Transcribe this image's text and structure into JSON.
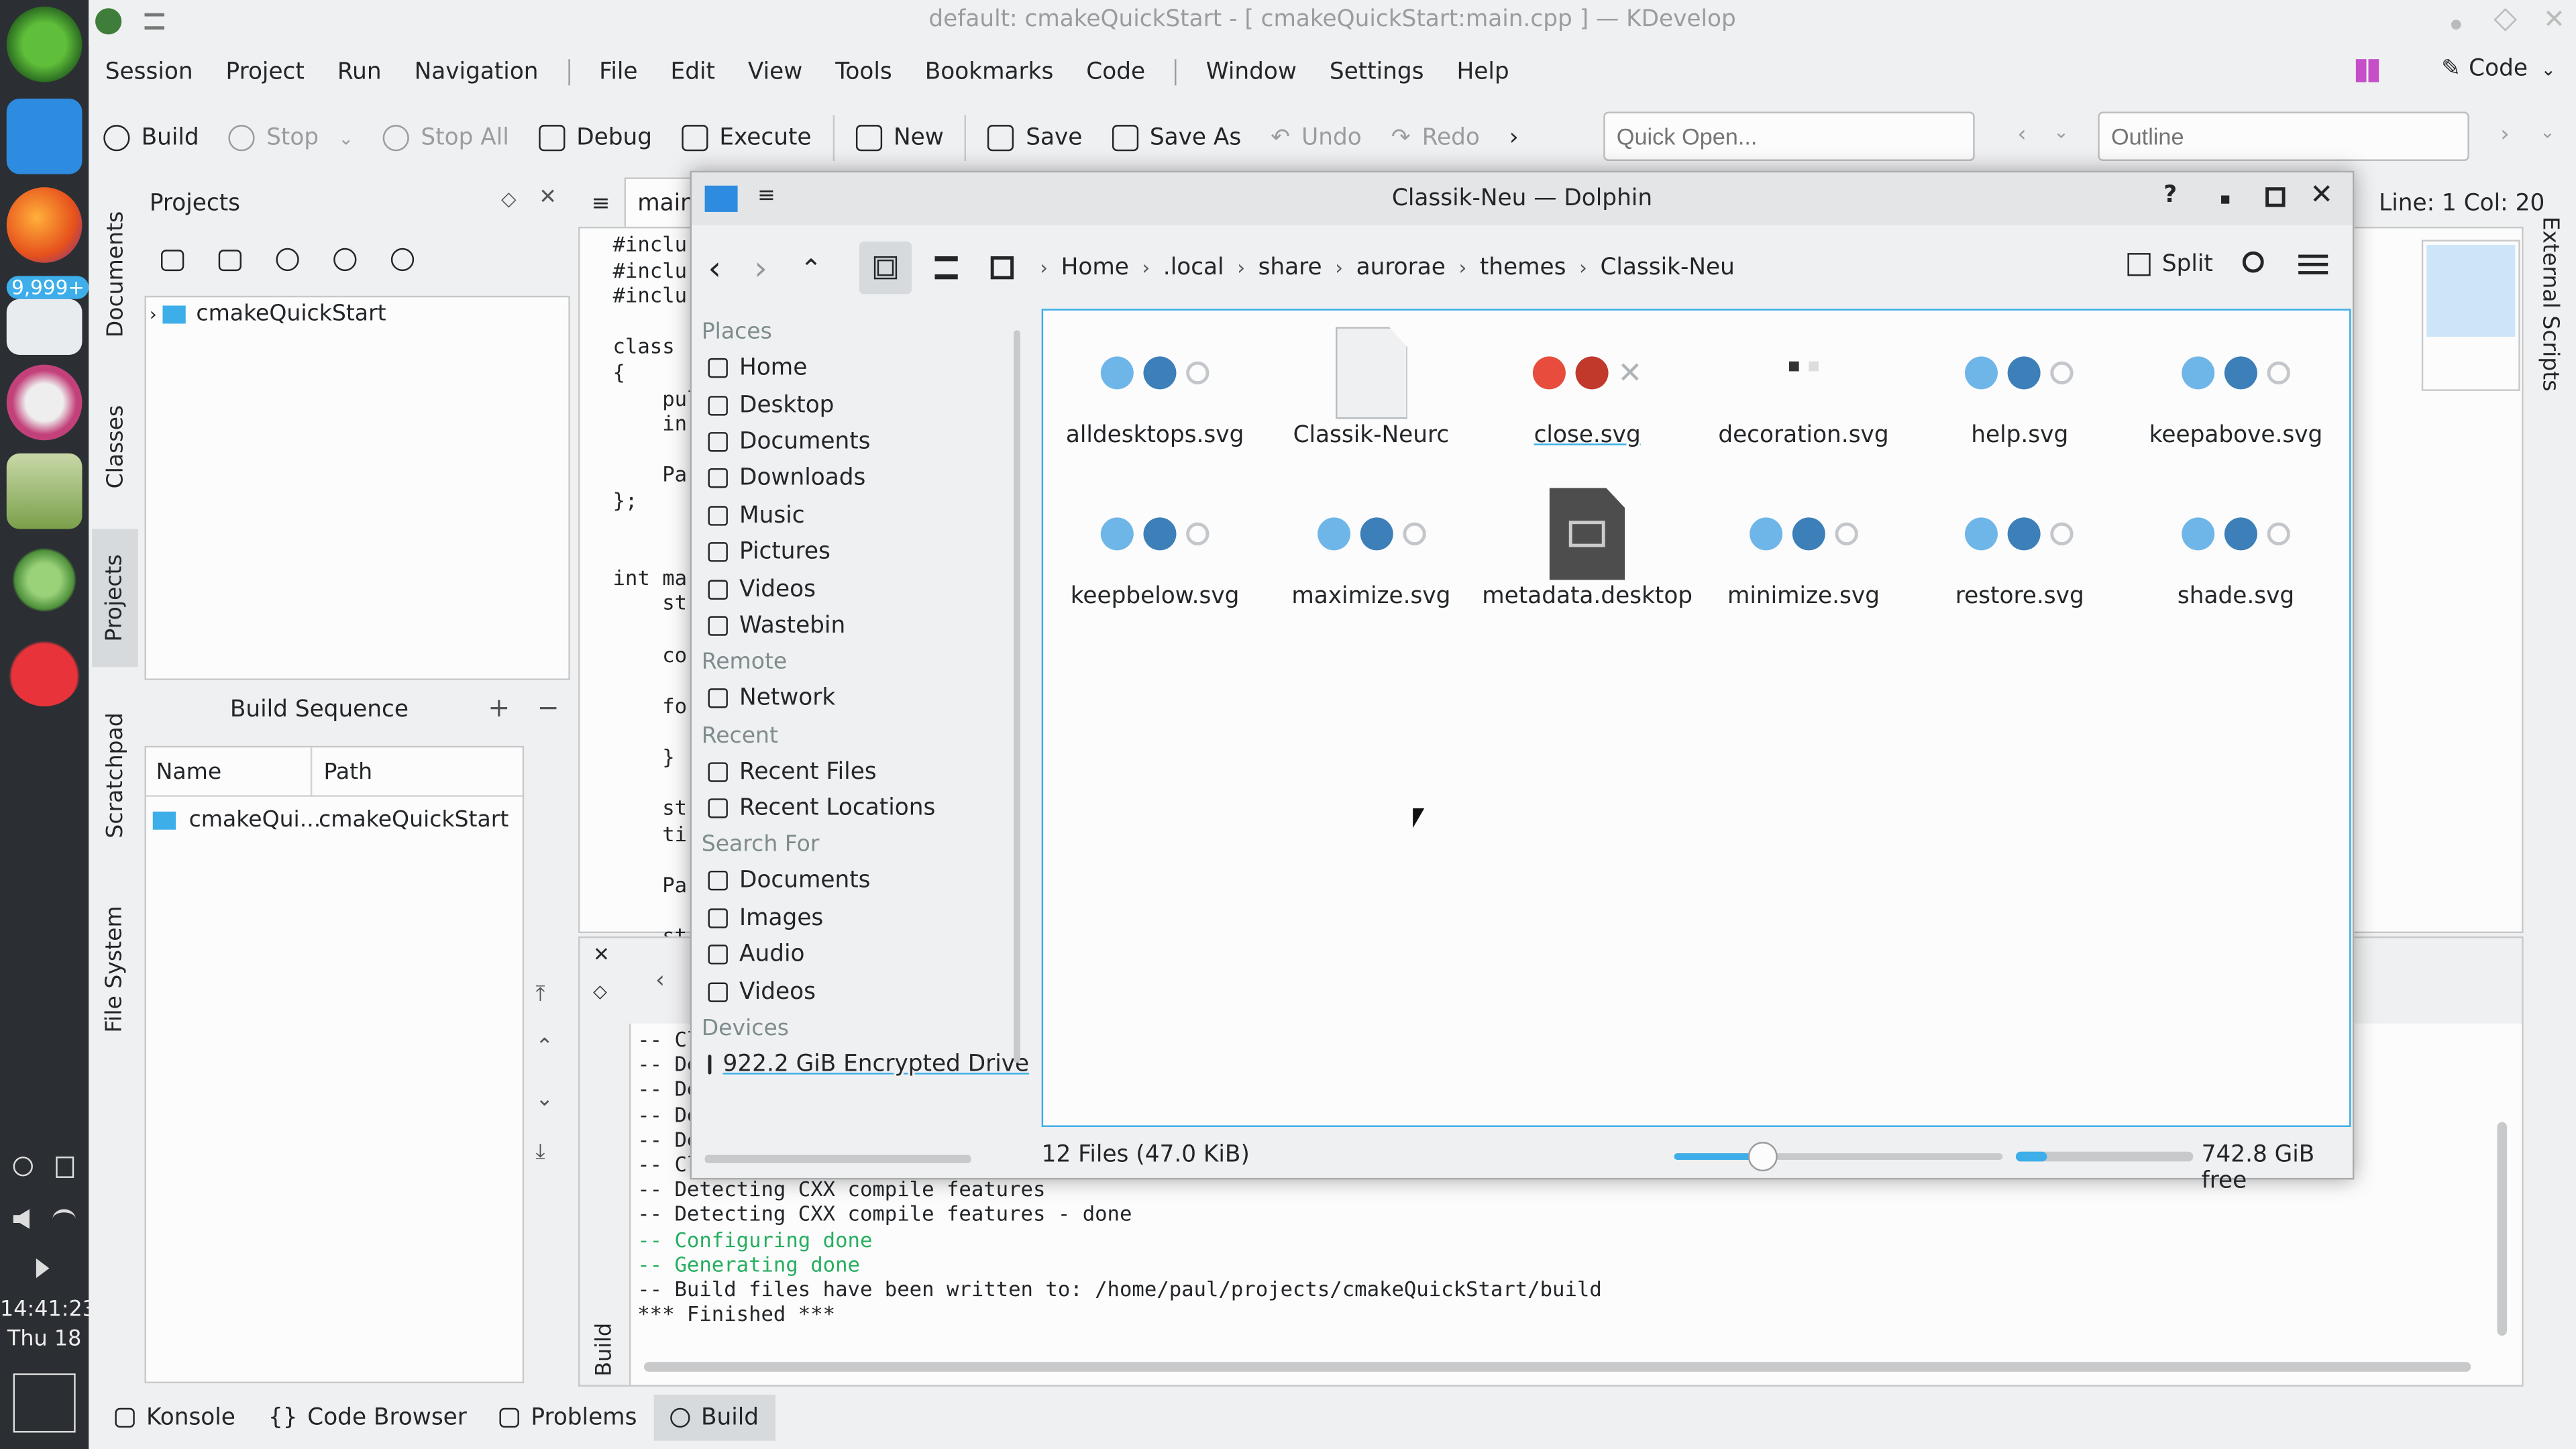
{
  "window_title": "default: cmakeQuickStart - [ cmakeQuickStart:main.cpp ] — KDevelop",
  "dock": {
    "badge": "9,999+",
    "time": "14:41:23",
    "date": "Thu 18"
  },
  "menu": [
    "Session",
    "Project",
    "Run",
    "Navigation",
    "File",
    "Edit",
    "View",
    "Tools",
    "Bookmarks",
    "Code",
    "Window",
    "Settings",
    "Help"
  ],
  "area_switch": "Code",
  "toolbar": {
    "build": "Build",
    "stop": "Stop",
    "stop_all": "Stop All",
    "debug": "Debug",
    "execute": "Execute",
    "new": "New",
    "save": "Save",
    "save_as": "Save As",
    "undo": "Undo",
    "redo": "Redo",
    "quick_open_placeholder": "Quick Open...",
    "outline_placeholder": "Outline"
  },
  "side_tabs": [
    "Documents",
    "Classes",
    "Projects",
    "Scratchpad",
    "File System"
  ],
  "projects_panel": {
    "title": "Projects",
    "tree_item": "cmakeQuickStart"
  },
  "build_sequence": {
    "title": "Build Sequence",
    "col_name": "Name",
    "col_path": "Path",
    "row_name": "cmakeQui...",
    "row_path": "cmakeQuickStart"
  },
  "editor": {
    "tab": "main",
    "lines": [
      "#inclu",
      "#inclu",
      "#inclu",
      "",
      "class",
      "{",
      "    pul",
      "    in",
      "",
      "    Pa",
      "};",
      "",
      "",
      "int ma",
      "    st",
      "",
      "    co",
      "",
      "    fo",
      "",
      "    }",
      "",
      "    st",
      "    ti",
      "",
      "    Pa",
      "",
      "    st"
    ],
    "cursor": "Line: 1 Col: 20",
    "right_tab": "External Scripts"
  },
  "output": {
    "side_label": "Build",
    "lines": [
      {
        "text": "-- Cl",
        "green": false
      },
      {
        "text": "-- De",
        "green": false
      },
      {
        "text": "-- De",
        "green": false
      },
      {
        "text": "-- De",
        "green": false
      },
      {
        "text": "-- De",
        "green": false
      },
      {
        "text": "-- Cl",
        "green": false
      },
      {
        "text": "-- Detecting CXX compile features",
        "green": false
      },
      {
        "text": "-- Detecting CXX compile features - done",
        "green": false
      },
      {
        "text": "-- Configuring done",
        "green": true
      },
      {
        "text": "-- Generating done",
        "green": true
      },
      {
        "text": "-- Build files have been written to: /home/paul/projects/cmakeQuickStart/build",
        "green": false
      },
      {
        "text": "*** Finished ***",
        "green": false
      }
    ]
  },
  "bottom_tabs": [
    "Konsole",
    "Code Browser",
    "Problems",
    "Build"
  ],
  "dolphin": {
    "title": "Classik-Neu — Dolphin",
    "breadcrumb": [
      "Home",
      ".local",
      "share",
      "aurorae",
      "themes",
      "Classik-Neu"
    ],
    "split": "Split",
    "places": {
      "places_header": "Places",
      "places": [
        "Home",
        "Desktop",
        "Documents",
        "Downloads",
        "Music",
        "Pictures",
        "Videos",
        "Wastebin"
      ],
      "remote_header": "Remote",
      "remote": [
        "Network"
      ],
      "recent_header": "Recent",
      "recent": [
        "Recent Files",
        "Recent Locations"
      ],
      "search_header": "Search For",
      "search": [
        "Documents",
        "Images",
        "Audio",
        "Videos"
      ],
      "devices_header": "Devices",
      "devices": [
        "922.2 GiB Encrypted Drive"
      ]
    },
    "files": [
      "alldesktops.svg",
      "Classik-Neurc",
      "close.svg",
      "decoration.svg",
      "help.svg",
      "keepabove.svg",
      "keepbelow.svg",
      "maximize.svg",
      "metadata.desktop",
      "minimize.svg",
      "restore.svg",
      "shade.svg"
    ],
    "status": "12 Files (47.0 KiB)",
    "free": "742.8 GiB free",
    "zoom_level": 0.27,
    "disk_used_fraction": 0.18
  }
}
